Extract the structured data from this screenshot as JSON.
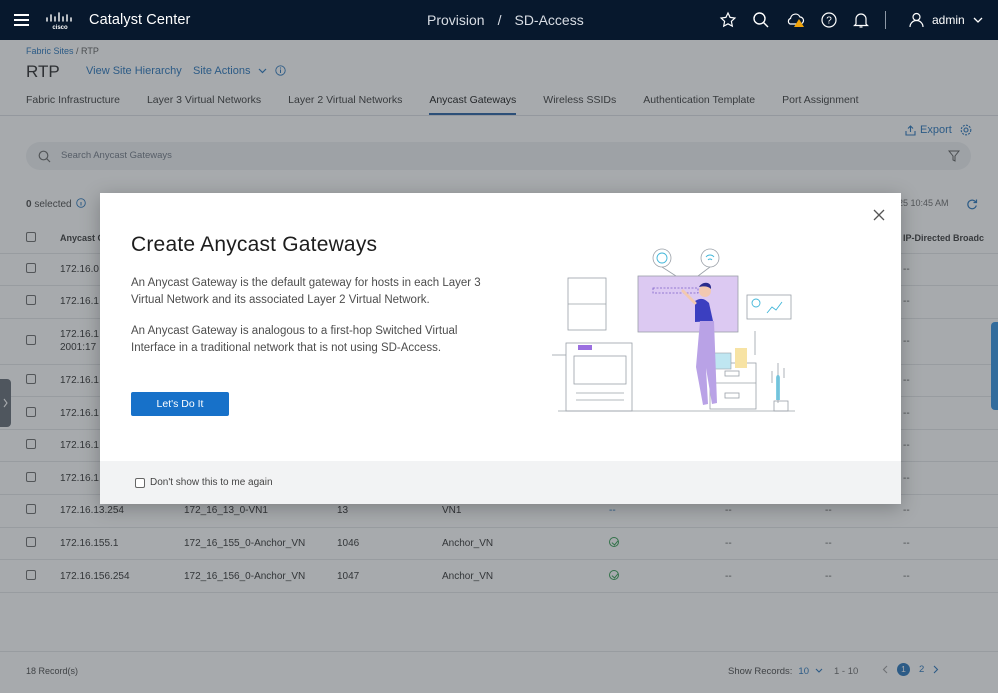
{
  "app": {
    "product_name": "Catalyst Center",
    "nav_section": "Provision",
    "nav_page": "SD-Access",
    "user": "admin"
  },
  "breadcrumb": {
    "root": "Fabric Sites",
    "current": "RTP"
  },
  "site": {
    "title": "RTP",
    "view_hierarchy": "View Site Hierarchy",
    "site_actions": "Site Actions"
  },
  "tabs": [
    {
      "label": "Fabric Infrastructure"
    },
    {
      "label": "Layer 3 Virtual Networks"
    },
    {
      "label": "Layer 2 Virtual Networks"
    },
    {
      "label": "Anycast Gateways",
      "active": true
    },
    {
      "label": "Wireless SSIDs"
    },
    {
      "label": "Authentication Template"
    },
    {
      "label": "Port Assignment"
    }
  ],
  "toolbar": {
    "export_label": "Export",
    "search_placeholder": "Search Anycast Gateways"
  },
  "selection": {
    "count": "0",
    "label": "selected"
  },
  "table_meta": {
    "timestamp_fragment": "25 10:45 AM"
  },
  "table": {
    "headers": {
      "col1": "Anycast G",
      "last": "IP-Directed Broadc"
    },
    "rows": [
      {
        "ip": "172.16.0",
        "last": "--"
      },
      {
        "ip": "172.16.1",
        "last": "--"
      },
      {
        "ip": "172.16.1",
        "ip2": "2001:17",
        "last": "--"
      },
      {
        "ip": "172.16.1",
        "last": "--"
      },
      {
        "ip": "172.16.1",
        "last": "--"
      },
      {
        "ip": "172.16.1",
        "last": "--"
      },
      {
        "ip": "172.16.1",
        "last": "--"
      },
      {
        "ip": "172.16.13.254",
        "name": "172_16_13_0-VN1",
        "vlan": "13",
        "vn": "VN1",
        "status": "--",
        "c6": "--",
        "c7": "--",
        "last": "--"
      },
      {
        "ip": "172.16.155.1",
        "name": "172_16_155_0-Anchor_VN",
        "vlan": "1046",
        "vn": "Anchor_VN",
        "status": "ok",
        "c6": "--",
        "c7": "--",
        "last": "--"
      },
      {
        "ip": "172.16.156.254",
        "name": "172_16_156_0-Anchor_VN",
        "vlan": "1047",
        "vn": "Anchor_VN",
        "status": "ok",
        "c6": "--",
        "c7": "--",
        "last": "--"
      }
    ]
  },
  "footer": {
    "records": "18 Record(s)",
    "show_records_label": "Show Records:",
    "show_records_value": "10",
    "range": "1 - 10",
    "pages": [
      "1",
      "2"
    ]
  },
  "modal": {
    "title": "Create Anycast Gateways",
    "paragraph1": "An Anycast Gateway is the default gateway for hosts in each Layer 3 Virtual Network and its associated Layer 2 Virtual Network.",
    "paragraph2": "An Anycast Gateway is analogous to a first-hop Switched Virtual Interface in a traditional network that is not using SD-Access.",
    "cta_label": "Let's Do It",
    "dont_show_label": "Don't show this to me again"
  },
  "colors": {
    "topbar": "#07182d",
    "accent": "#1771c9",
    "link": "#1f6fb8",
    "success": "#2b9a4a",
    "warning": "#f0a30a"
  }
}
